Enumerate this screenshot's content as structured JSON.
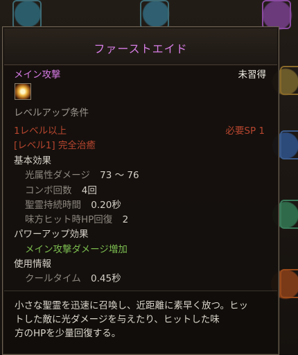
{
  "tooltip": {
    "title": "ファーストエイド",
    "category": "メイン攻撃",
    "status": "未習得",
    "requirements_header": "レベルアップ条件",
    "req_level": "1レベル以上",
    "req_sp": "必要SP 1",
    "req_skill": "[レベル1] 完全治癒",
    "basic_effect_header": "基本効果",
    "stats": [
      {
        "label": "光属性ダメージ",
        "value": "73 ～ 76"
      },
      {
        "label": "コンボ回数",
        "value": "4回"
      },
      {
        "label": "聖霊持続時間",
        "value": "0.20秒"
      },
      {
        "label": "味方ヒット時HP回復",
        "value": "2"
      }
    ],
    "powerup_header": "パワーアップ効果",
    "powerup_effect": "メイン攻撃ダメージ増加",
    "usage_header": "使用情報",
    "cooldown_label": "クールタイム",
    "cooldown_value": "0.45秒",
    "description_lines": [
      "小さな聖霊を迅速に召喚し、近距離に素早く放つ。ヒッ",
      "トした敵に光ダメージを与えたり、ヒットした味",
      "方のHPを少量回復する。"
    ]
  },
  "colors": {
    "title": "#d77ee6",
    "category": "#d67ae4",
    "requirement": "#b8462f",
    "powerup": "#7bbc4f"
  },
  "icons": {
    "skill": "first-aid-skill-icon"
  }
}
